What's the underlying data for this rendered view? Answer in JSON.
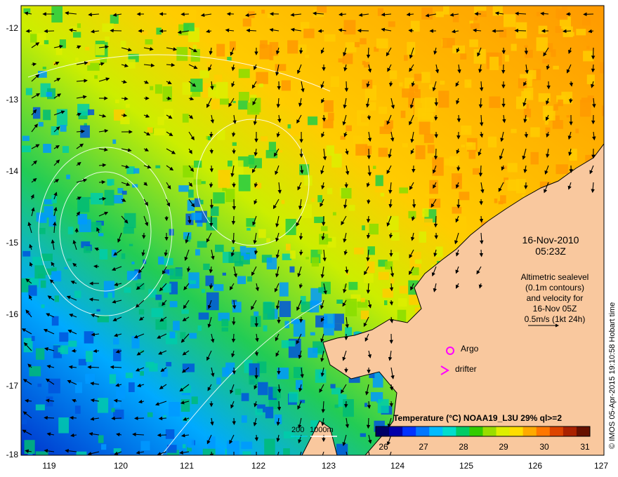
{
  "map": {
    "lon_ticks": [
      "119",
      "120",
      "121",
      "122",
      "123",
      "124",
      "125",
      "126",
      "127"
    ],
    "lat_ticks": [
      "-12",
      "-13",
      "-14",
      "-15",
      "-16",
      "-17",
      "-18"
    ]
  },
  "annotations": {
    "date": "16-Nov-2010",
    "time": "05:23Z",
    "altimetric": [
      "Altimetric sealevel",
      "(0.1m contours)",
      "and velocity for",
      "16-Nov 05Z",
      "0.5m/s (1kt 24h)"
    ]
  },
  "legend": {
    "argo": "Argo",
    "drifter": "drifter",
    "argo_color": "#ff00ff",
    "drifter_color": "#ff00ff"
  },
  "depth_contours": {
    "label_200": "200",
    "label_1000": "1000m",
    "color_200": "#00ccdd",
    "color_1000": "#ffffff"
  },
  "colorbar": {
    "title": "Temperature (°C) NOAA19_L3U 29% ql>=2",
    "ticks": [
      "26",
      "27",
      "28",
      "29",
      "30",
      "31"
    ],
    "colors": [
      "#000066",
      "#0000aa",
      "#0033ff",
      "#0077ff",
      "#00bbff",
      "#00ddcc",
      "#00cc66",
      "#33cc00",
      "#99dd00",
      "#ddee00",
      "#ffdd00",
      "#ffaa00",
      "#ff7700",
      "#dd4400",
      "#aa2200",
      "#661100"
    ]
  },
  "credit": "© IMOS 05-Apr-2015 19:10:58 Hobart time",
  "colors": {
    "land": "#f9c89e",
    "coast": "#000000",
    "arrow": "#000000"
  }
}
